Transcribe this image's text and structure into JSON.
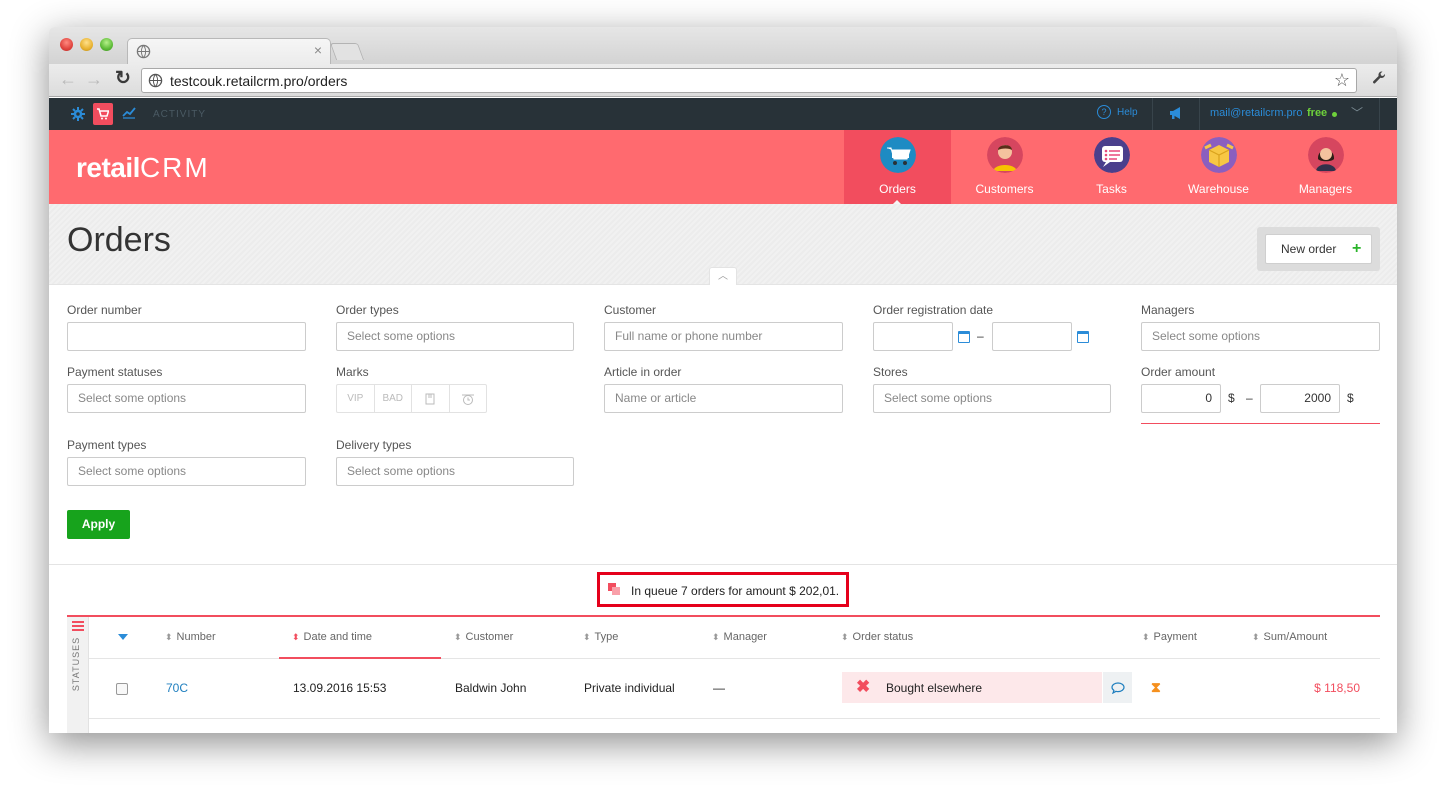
{
  "browser": {
    "tab_close": "×",
    "url": "testcouk.retailcrm.pro/orders"
  },
  "appbar": {
    "activity": "ACTIVITY",
    "help": "Help",
    "email": "mail@retailcrm.pro",
    "plan": "free"
  },
  "brand": {
    "logo_text": "retail",
    "logo_crm": "CRM"
  },
  "nav": [
    {
      "label": "Orders",
      "icon": "cart-icon",
      "active": true
    },
    {
      "label": "Customers",
      "icon": "customer-avatar-icon"
    },
    {
      "label": "Tasks",
      "icon": "tasks-icon"
    },
    {
      "label": "Warehouse",
      "icon": "box-icon"
    },
    {
      "label": "Managers",
      "icon": "manager-avatar-icon"
    }
  ],
  "page": {
    "title": "Orders",
    "new_order": "New order"
  },
  "filters": {
    "order_number": {
      "label": "Order number",
      "value": ""
    },
    "order_types": {
      "label": "Order types",
      "placeholder": "Select some options"
    },
    "customer": {
      "label": "Customer",
      "placeholder": "Full name or phone number"
    },
    "registration_date": {
      "label": "Order registration date",
      "from": "",
      "to": "",
      "dash": "–"
    },
    "managers": {
      "label": "Managers",
      "placeholder": "Select some options"
    },
    "payment_statuses": {
      "label": "Payment statuses",
      "placeholder": "Select some options"
    },
    "marks": {
      "label": "Marks",
      "items": [
        "VIP",
        "BAD"
      ]
    },
    "article": {
      "label": "Article in order",
      "placeholder": "Name or article"
    },
    "stores": {
      "label": "Stores",
      "placeholder": "Select some options"
    },
    "order_amount": {
      "label": "Order amount",
      "from": "0",
      "to": "2000",
      "currency": "$",
      "dash": "–"
    },
    "payment_types": {
      "label": "Payment types",
      "placeholder": "Select some options"
    },
    "delivery_types": {
      "label": "Delivery types",
      "placeholder": "Select some options"
    },
    "apply": "Apply"
  },
  "queue": {
    "text": "In queue 7 orders for amount $ 202,01."
  },
  "table": {
    "statuses_label": "STATUSES",
    "columns": [
      "Number",
      "Date and time",
      "Customer",
      "Type",
      "Manager",
      "Order status",
      "Payment",
      "Sum/Amount"
    ],
    "rows": [
      {
        "number": "70C",
        "datetime": "13.09.2016 15:53",
        "customer": "Baldwin John",
        "type": "Private individual",
        "manager": "—",
        "status": "Bought elsewhere",
        "sum": "$ 118,50"
      }
    ]
  },
  "colors": {
    "brand": "#ff6a6f",
    "accent": "#f24d5e",
    "link": "#1f7fbf",
    "apply": "#17a31c",
    "queue_border": "#e5001b"
  }
}
